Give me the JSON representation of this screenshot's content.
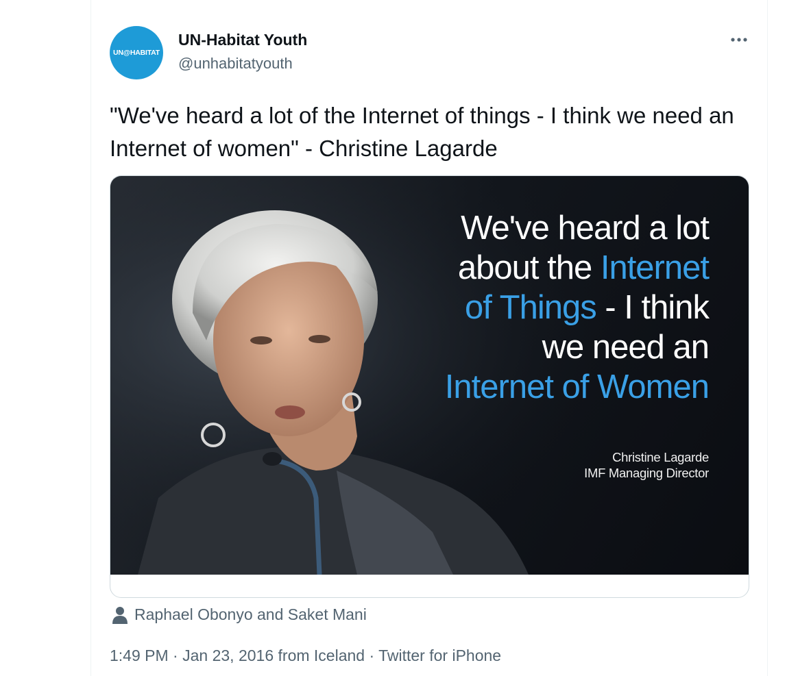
{
  "tweet": {
    "avatar_text": "UN@HABITAT",
    "display_name": "UN-Habitat Youth",
    "handle": "@unhabitatyouth",
    "more_icon": "more-horizontal-icon",
    "text": "\"We've heard a lot of the Internet of things - I think we need an Internet of women\" - Christine Lagarde",
    "image": {
      "quote_lines": [
        {
          "pre": "We've heard a lot",
          "hl": "",
          "post": ""
        },
        {
          "pre": "about the ",
          "hl": "Internet",
          "post": ""
        },
        {
          "pre": "",
          "hl": "of Things",
          "post": " - I think"
        },
        {
          "pre": "we need an",
          "hl": "",
          "post": ""
        },
        {
          "pre": "",
          "hl": "Internet of Women",
          "post": ""
        }
      ],
      "attribution_name": "Christine Lagarde",
      "attribution_title": "IMF Managing Director",
      "highlight_color": "#3aa0e6"
    },
    "tagged_users": "Raphael Obonyo and Saket Mani",
    "tagged_icon": "person-icon",
    "time": "1:49 PM",
    "sep1": " · ",
    "date": "Jan 23, 2016",
    "location": " from Iceland",
    "sep2": " · ",
    "source": "Twitter for iPhone"
  },
  "colors": {
    "text_primary": "#0f1419",
    "text_secondary": "#536471",
    "avatar_bg": "#1e9bd7"
  }
}
